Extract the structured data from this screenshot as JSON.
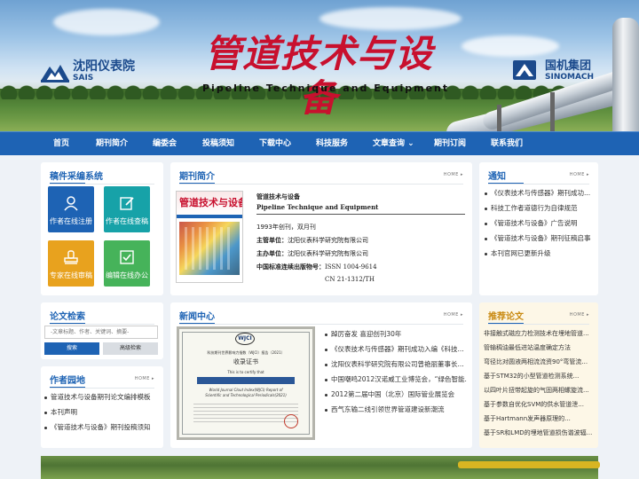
{
  "header": {
    "title_cn": "管道技术与设备",
    "registered_mark": "®",
    "title_en": "Pipeline Technique and Equipment",
    "left_logo": {
      "name_cn": "沈阳仪表院",
      "name_en": "SAIS"
    },
    "right_logo": {
      "name_cn": "国机集团",
      "name_en": "SINOMACH"
    }
  },
  "nav": {
    "items": [
      {
        "label": "首页"
      },
      {
        "label": "期刊简介"
      },
      {
        "label": "编委会"
      },
      {
        "label": "投稿须知"
      },
      {
        "label": "下载中心"
      },
      {
        "label": "科技服务"
      },
      {
        "label": "文章查询"
      },
      {
        "label": "期刊订阅"
      },
      {
        "label": "联系我们"
      }
    ],
    "dropdown_arrow": "⌄"
  },
  "submission": {
    "title": "稿件采编系统",
    "tiles": [
      {
        "label": "作者在线注册",
        "icon": "user-icon",
        "color": "#1e63b4"
      },
      {
        "label": "作者在线查稿",
        "icon": "edit-icon",
        "color": "#17a2a8"
      },
      {
        "label": "专家在线审稿",
        "icon": "stamp-icon",
        "color": "#e8a21e"
      },
      {
        "label": "编辑在线办公",
        "icon": "check-icon",
        "color": "#46b35a"
      }
    ]
  },
  "intro": {
    "title": "期刊简介",
    "more": "HOME ▸",
    "cover_title": "管道技术与设备",
    "name_cn": "管道技术与设备",
    "name_en": "Pipeline Technique and Equipment",
    "founded": "1993年创刊，双月刊",
    "host_label": "主管单位：",
    "host": "沈阳仪表科学研究院有限公司",
    "sponsor_label": "主办单位：",
    "sponsor": "沈阳仪表科学研究院有限公司",
    "issn_label": "中国标准连续出版物号：",
    "issn": "ISSN 1004-9614",
    "cn": "CN  21-1312/TH"
  },
  "notice": {
    "title": "通知",
    "more": "HOME ▸",
    "items": [
      "《仪表技术与传感器》期刊成功...",
      "科技工作者道德行为自律规范",
      "《管道技术与设备》广告说明",
      "《管道技术与设备》期刊征稿启事",
      "本刊官网已更新升级"
    ]
  },
  "search": {
    "title": "论文检索",
    "placeholder": "-文章标题、作者、关键词、摘要-",
    "search_btn": "搜索",
    "advanced_btn": "高级检索"
  },
  "news": {
    "title": "新闻中心",
    "more": "HOME ▸",
    "items": [
      "踔厉奋发 喜迎创刊30年",
      "《仪表技术与传感器》期刊成功入编《科技...",
      "沈阳仪表科学研究院有限公司曾艳丽董事长...",
      "中国嘲鸣2012汉诺威工业博览会，“绿色智能...",
      "2012第二届中国（北京）国际管业展览会",
      "西气东输二线引领世界管道建设新潮流"
    ],
    "cert": {
      "logo": "WJCI",
      "line1": "科技期刊世界影响力指数（WJCI）报告（2021）",
      "line2": "收录证书",
      "line3": "This is to certify that",
      "line4": "World Journal Clout Index(WJCI) Report of",
      "line5": "Scientific and Technological Periodicals(2021)"
    }
  },
  "author": {
    "title": "作者园地",
    "more": "HOME ▸",
    "items": [
      "管道技术与设备期刊论文编排模板",
      "本刊声明",
      "《管道技术与设备》期刊投稿须知"
    ]
  },
  "recommended": {
    "title": "推荐论文",
    "more": "HOME ▸",
    "items": [
      "非接触式磁应力检测技术在埋地管道...",
      "管输稠油最低进站温度确定方法",
      "弯径比对圆液两相流流资90°弯管流...",
      "基于STM32的小型管道检测系统...",
      "以四叶片扭带起旋的气固两相螺旋流...",
      "基于参数自优化SVM的供水管道泄...",
      "基于Hartmann发声器原理的...",
      "基于SR和LMD的埋地管道损伤谐波辐..."
    ]
  }
}
